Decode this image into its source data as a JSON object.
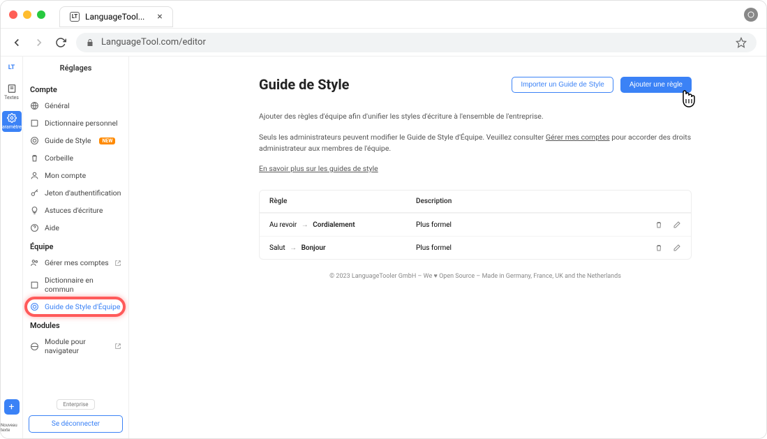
{
  "browser": {
    "tab_title": "LanguageTool...",
    "url": "LanguageTool.com/editor"
  },
  "rail": {
    "items": [
      {
        "label": "",
        "name": "logo"
      },
      {
        "label": "Textes",
        "name": "textes"
      },
      {
        "label": "Paramètres",
        "name": "parametres",
        "active": true
      }
    ],
    "new_label": "Nouveau texte"
  },
  "sidebar": {
    "title": "Réglages",
    "sections": [
      {
        "title": "Compte",
        "items": [
          {
            "label": "Général",
            "icon": "globe"
          },
          {
            "label": "Dictionnaire personnel",
            "icon": "book"
          },
          {
            "label": "Guide de Style",
            "icon": "target",
            "badge": "NEW"
          },
          {
            "label": "Corbeille",
            "icon": "trash"
          },
          {
            "label": "Mon compte",
            "icon": "user"
          },
          {
            "label": "Jeton d'authentification",
            "icon": "key"
          },
          {
            "label": "Astuces d'écriture",
            "icon": "bulb"
          },
          {
            "label": "Aide",
            "icon": "help"
          }
        ]
      },
      {
        "title": "Équipe",
        "items": [
          {
            "label": "Gérer mes comptes",
            "icon": "users",
            "external": true
          },
          {
            "label": "Dictionnaire en commun",
            "icon": "book"
          },
          {
            "label": "Guide de Style d'Équipe",
            "icon": "target",
            "highlighted": true
          }
        ]
      },
      {
        "title": "Modules",
        "items": [
          {
            "label": "Module pour navigateur",
            "icon": "globe",
            "external": true
          }
        ]
      }
    ],
    "enterprise": "Enterprise",
    "logout": "Se déconnecter"
  },
  "main": {
    "title": "Guide de Style",
    "import_button": "Importer un Guide de Style",
    "add_button": "Ajouter une règle",
    "desc1": "Ajouter des règles d'équipe afin d'unifier les styles d'écriture à l'ensemble de l'entreprise.",
    "desc2_pre": "Seuls les administrateurs peuvent modifier le Guide de Style d'Équipe. Veuillez consulter ",
    "desc2_link": "Gérer mes comptes",
    "desc2_post": " pour accorder des droits administrateur aux membres de l'équipe.",
    "learn_more": "En savoir plus sur les guides de style",
    "table": {
      "col_rule": "Règle",
      "col_desc": "Description",
      "rows": [
        {
          "from": "Au revoir",
          "to": "Cordialement",
          "desc": "Plus formel"
        },
        {
          "from": "Salut",
          "to": "Bonjour",
          "desc": "Plus formel"
        }
      ]
    },
    "footer": "© 2023 LanguageTooler GmbH – We ♥ Open Source – Made in Germany, France, UK and the Netherlands"
  }
}
